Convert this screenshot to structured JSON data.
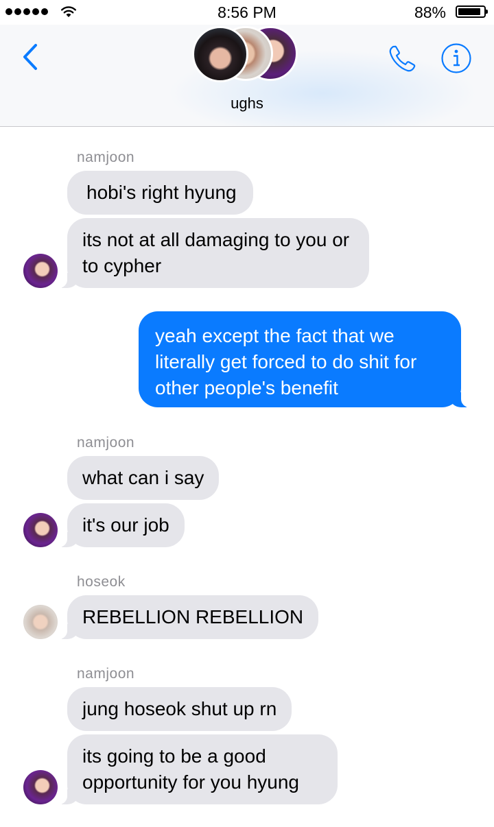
{
  "status_bar": {
    "time": "8:56 PM",
    "battery_percent": "88%",
    "battery_level": 0.88,
    "signal_dots": 5,
    "icons": [
      "signal-dots-icon",
      "wifi-icon",
      "battery-icon"
    ]
  },
  "header": {
    "group_name": "ughs",
    "avatars": [
      "member-avatar-1",
      "member-avatar-2",
      "member-avatar-3"
    ],
    "icons": [
      "back-chevron-icon",
      "phone-icon",
      "info-icon"
    ],
    "accent_color": "#0a7bff"
  },
  "messages": [
    {
      "sender": "namjoon",
      "direction": "incoming",
      "text": "hobi's right hyung"
    },
    {
      "sender": "namjoon",
      "direction": "incoming",
      "text": "its not at all damaging to you or to cypher"
    },
    {
      "sender": "me",
      "direction": "outgoing",
      "text": "yeah except the fact that we literally get forced to do shit for other people's benefit"
    },
    {
      "sender": "namjoon",
      "direction": "incoming",
      "text": "what can i say"
    },
    {
      "sender": "namjoon",
      "direction": "incoming",
      "text": "it's our job"
    },
    {
      "sender": "hoseok",
      "direction": "incoming",
      "text": "REBELLION REBELLION"
    },
    {
      "sender": "namjoon",
      "direction": "incoming",
      "text": "jung hoseok shut up rn"
    },
    {
      "sender": "namjoon",
      "direction": "incoming",
      "text": "its going to be a good opportunity for you hyung"
    }
  ],
  "colors": {
    "incoming_bubble": "#e5e5ea",
    "outgoing_bubble": "#0a7bff",
    "sender_label": "#8e8e93"
  }
}
